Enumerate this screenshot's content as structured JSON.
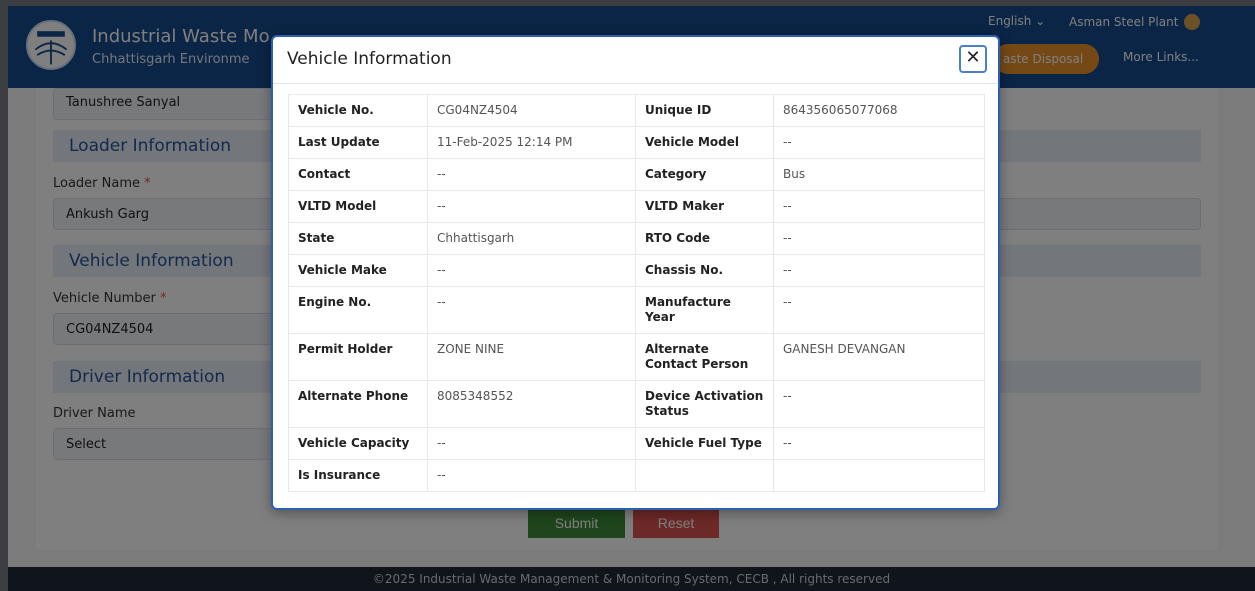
{
  "header": {
    "title": "Industrial Waste Mo",
    "subtitle": "Chhattisgarh Environme",
    "language": "English ⌄",
    "user": "Asman Steel Plant",
    "nav_active": "aste Disposal",
    "nav_more": "More Links..."
  },
  "form": {
    "top_value": "Tanushree Sanyal",
    "loader_section": "Loader Information",
    "loader_label": "Loader Name",
    "loader_value": "Ankush Garg",
    "vehicle_section": "Vehicle Information",
    "vehicle_label": "Vehicle Number",
    "vehicle_value": "CG04NZ4504",
    "driver_section": "Driver Information",
    "driver_label": "Driver Name",
    "driver_value": "Select",
    "required_mark": "*",
    "submit_label": "Submit",
    "reset_label": "Reset"
  },
  "footer": {
    "text": "©2025 Industrial Waste Management & Monitoring System, CECB , All rights reserved"
  },
  "modal": {
    "title": "Vehicle Information",
    "close_glyph": "✕",
    "rows": [
      {
        "l1": "Vehicle No.",
        "v1": "CG04NZ4504",
        "l2": "Unique ID",
        "v2": "864356065077068"
      },
      {
        "l1": "Last Update",
        "v1": "11-Feb-2025 12:14 PM",
        "l2": "Vehicle Model",
        "v2": "--"
      },
      {
        "l1": "Contact",
        "v1": "--",
        "l2": "Category",
        "v2": "Bus"
      },
      {
        "l1": "VLTD Model",
        "v1": "--",
        "l2": "VLTD Maker",
        "v2": "--"
      },
      {
        "l1": "State",
        "v1": "Chhattisgarh",
        "l2": "RTO Code",
        "v2": "--"
      },
      {
        "l1": "Vehicle Make",
        "v1": "--",
        "l2": "Chassis No.",
        "v2": "--"
      },
      {
        "l1": "Engine No.",
        "v1": "--",
        "l2": "Manufacture Year",
        "v2": "--"
      },
      {
        "l1": "Permit Holder",
        "v1": "ZONE NINE",
        "l2": "Alternate Contact Person",
        "v2": "GANESH DEVANGAN"
      },
      {
        "l1": "Alternate Phone",
        "v1": "8085348552",
        "l2": "Device Activation Status",
        "v2": "--"
      },
      {
        "l1": "Vehicle Capacity",
        "v1": "--",
        "l2": "Vehicle Fuel Type",
        "v2": "--"
      },
      {
        "l1": "Is Insurance",
        "v1": "--",
        "l2": "",
        "v2": ""
      }
    ]
  }
}
